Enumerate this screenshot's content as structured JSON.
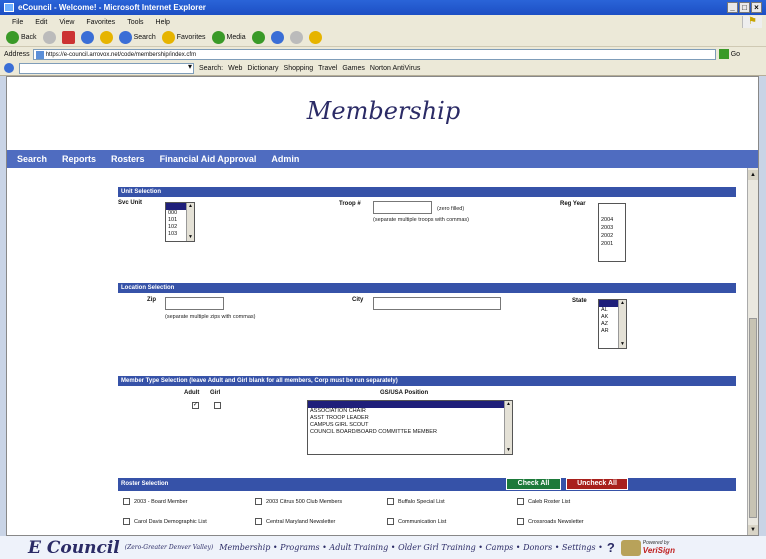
{
  "window": {
    "title": "eCouncil - Welcome! - Microsoft Internet Explorer",
    "controls": [
      "_",
      "□",
      "×"
    ]
  },
  "menu": [
    "File",
    "Edit",
    "View",
    "Favorites",
    "Tools",
    "Help"
  ],
  "toolbar": {
    "back": "Back",
    "search": "Search",
    "favorites": "Favorites",
    "media": "Media"
  },
  "address": {
    "label": "Address",
    "url": "https://e-council.arrovox.net/code/membership/index.cfm",
    "go": "Go"
  },
  "searchbar": {
    "search": "Search:",
    "web": "Web",
    "dictionary": "Dictionary",
    "shopping": "Shopping",
    "travel": "Travel",
    "games": "Games",
    "norton": "Norton AntiVirus"
  },
  "page": {
    "title": "Membership",
    "nav": [
      "Search",
      "Reports",
      "Rosters",
      "Financial Aid Approval",
      "Admin"
    ],
    "unit": {
      "header": "Unit Selection",
      "svc_unit_label": "Svc Unit",
      "svc_units": [
        "",
        "000",
        "101",
        "102",
        "103"
      ],
      "troop_label": "Troop #",
      "troop_hint1": "(zero filled)",
      "troop_hint2": "(separate multiple troops with commas)",
      "reg_year_label": "Reg Year",
      "reg_years": [
        "2004",
        "2003",
        "2002",
        "2001"
      ]
    },
    "location": {
      "header": "Location Selection",
      "zip_label": "Zip",
      "zip_hint": "(separate multiple zips with commas)",
      "city_label": "City",
      "state_label": "State",
      "states": [
        "",
        "AL",
        "AK",
        "AZ",
        "AR"
      ]
    },
    "member_type": {
      "header": "Member Type Selection (leave Adult and Girl blank for all members, Corp must be run separately)",
      "adult_label": "Adult",
      "girl_label": "Girl",
      "adult_checked": true,
      "girl_checked": false,
      "position_label": "GS/USA Position",
      "positions": [
        "",
        "ASSOCIATION CHAIR",
        "ASST TROOP LEADER",
        "CAMPUS GIRL SCOUT",
        "COUNCIL BOARD/BOARD COMMITTEE MEMBER"
      ]
    },
    "roster": {
      "header": "Roster Selection",
      "check_all": "Check All",
      "uncheck_all": "Uncheck All",
      "items": [
        "2003 - Board Member",
        "2003 Citrus 500 Club Members",
        "Buffalo Special List",
        "Caleb Roster List",
        "Carol Davis Demographic List",
        "Central Maryland Newsletter",
        "Communication List",
        "Crossroads Newsletter"
      ]
    }
  },
  "footer": {
    "brand": "E Council",
    "tagline": "(Zero-Greater Denver Valley)",
    "links": "Membership • Programs • Adult Training • Older Girl Training • Camps • Donors • Settings •",
    "help": "?",
    "verisign": "VeriSign",
    "verisign_small": "Powered by"
  },
  "colors": {
    "nav": "#4f6cc0",
    "section": "#3652a8",
    "check_all": "#1d7a3a",
    "uncheck_all": "#a8201c",
    "title": "#2b2b66"
  }
}
